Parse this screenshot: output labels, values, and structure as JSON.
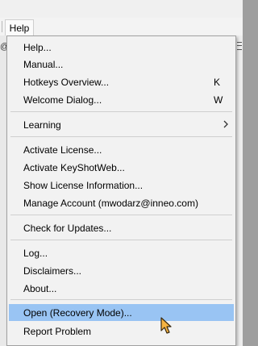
{
  "menubar": {
    "help_label": "Help"
  },
  "help_menu": {
    "items": [
      {
        "label": "Help..."
      },
      {
        "label": "Manual..."
      },
      {
        "label": "Hotkeys Overview...",
        "shortcut": "K"
      },
      {
        "label": "Welcome Dialog...",
        "shortcut": "W"
      },
      {
        "label": "Learning",
        "has_submenu": true
      },
      {
        "label": "Activate License..."
      },
      {
        "label": "Activate KeyShotWeb..."
      },
      {
        "label": "Show License Information..."
      },
      {
        "label": "Manage Account (mwodarz@inneo.com)"
      },
      {
        "label": "Check for Updates..."
      },
      {
        "label": "Log..."
      },
      {
        "label": "Disclaimers..."
      },
      {
        "label": "About..."
      },
      {
        "label": "Open (Recovery Mode)...",
        "highlighted": true
      },
      {
        "label": "Report Problem"
      }
    ]
  },
  "icons": {
    "submenu_arrow": "chevron-right-icon",
    "cursor": "mouse-pointer-icon"
  },
  "colors": {
    "menu_bg": "#f2f2f2",
    "highlight": "#99c4f3",
    "cursor_fill": "#f5b342"
  }
}
